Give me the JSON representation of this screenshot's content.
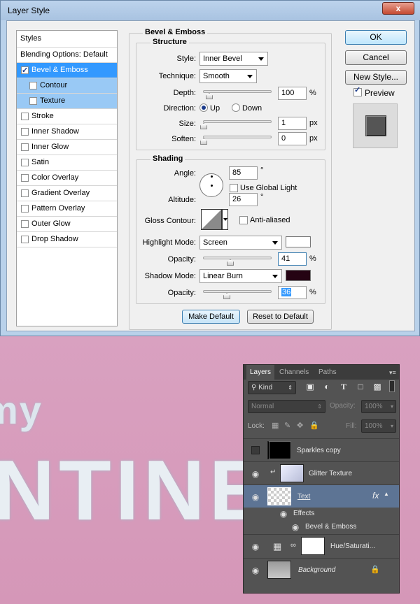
{
  "dialog": {
    "title": "Layer Style",
    "close_label": "x",
    "styles_header": "Styles",
    "style_items": [
      {
        "label": "Blending Options: Default",
        "checkbox": false,
        "checked": false,
        "state": "normal"
      },
      {
        "label": "Bevel & Emboss",
        "checkbox": true,
        "checked": true,
        "state": "selected"
      },
      {
        "label": "Contour",
        "checkbox": true,
        "checked": false,
        "state": "sub"
      },
      {
        "label": "Texture",
        "checkbox": true,
        "checked": false,
        "state": "sub"
      },
      {
        "label": "Stroke",
        "checkbox": true,
        "checked": false,
        "state": "normal"
      },
      {
        "label": "Inner Shadow",
        "checkbox": true,
        "checked": false,
        "state": "normal"
      },
      {
        "label": "Inner Glow",
        "checkbox": true,
        "checked": false,
        "state": "normal"
      },
      {
        "label": "Satin",
        "checkbox": true,
        "checked": false,
        "state": "normal"
      },
      {
        "label": "Color Overlay",
        "checkbox": true,
        "checked": false,
        "state": "normal"
      },
      {
        "label": "Gradient Overlay",
        "checkbox": true,
        "checked": false,
        "state": "normal"
      },
      {
        "label": "Pattern Overlay",
        "checkbox": true,
        "checked": false,
        "state": "normal"
      },
      {
        "label": "Outer Glow",
        "checkbox": true,
        "checked": false,
        "state": "normal"
      },
      {
        "label": "Drop Shadow",
        "checkbox": true,
        "checked": false,
        "state": "normal"
      }
    ],
    "bevel": {
      "group_title": "Bevel & Emboss",
      "structure_title": "Structure",
      "style_label": "Style:",
      "style_value": "Inner Bevel",
      "technique_label": "Technique:",
      "technique_value": "Smooth",
      "depth_label": "Depth:",
      "depth_value": "100",
      "depth_unit": "%",
      "direction_label": "Direction:",
      "dir_up": "Up",
      "dir_down": "Down",
      "direction_selected": "Up",
      "size_label": "Size:",
      "size_value": "1",
      "size_unit": "px",
      "soften_label": "Soften:",
      "soften_value": "0",
      "soften_unit": "px"
    },
    "shading": {
      "title": "Shading",
      "angle_label": "Angle:",
      "angle_value": "85",
      "angle_unit": "°",
      "use_global_light": "Use Global Light",
      "altitude_label": "Altitude:",
      "altitude_value": "26",
      "altitude_unit": "°",
      "gloss_label": "Gloss Contour:",
      "anti_aliased": "Anti-aliased",
      "highlight_mode_label": "Highlight Mode:",
      "highlight_mode_value": "Screen",
      "highlight_color": "#ffffff",
      "highlight_opacity_label": "Opacity:",
      "highlight_opacity_value": "41",
      "shadow_mode_label": "Shadow Mode:",
      "shadow_mode_value": "Linear Burn",
      "shadow_color": "#250313",
      "shadow_opacity_label": "Opacity:",
      "shadow_opacity_value": "36",
      "percent": "%"
    },
    "make_default": "Make Default",
    "reset_default": "Reset to Default",
    "ok": "OK",
    "cancel": "Cancel",
    "new_style": "New Style...",
    "preview_label": "Preview",
    "preview_checked": true
  },
  "canvas": {
    "line1": "my",
    "line2": "NTINE"
  },
  "layers_panel": {
    "tabs": [
      "Layers",
      "Channels",
      "Paths"
    ],
    "active_tab": "Layers",
    "kind_label": "Kind",
    "blend_mode": "Normal",
    "opacity_label": "Opacity:",
    "opacity_value": "100%",
    "lock_label": "Lock:",
    "fill_label": "Fill:",
    "fill_value": "100%",
    "layers": [
      {
        "name": "Sparkles copy",
        "visible": false
      },
      {
        "name": "Glitter Texture",
        "visible": true
      },
      {
        "name": "Text",
        "visible": true,
        "fx": "fx"
      },
      {
        "name": "Effects",
        "visible": true
      },
      {
        "name": "Bevel & Emboss",
        "visible": true
      },
      {
        "name": "Hue/Saturati...",
        "visible": true
      },
      {
        "name": "Background",
        "visible": true
      }
    ]
  }
}
